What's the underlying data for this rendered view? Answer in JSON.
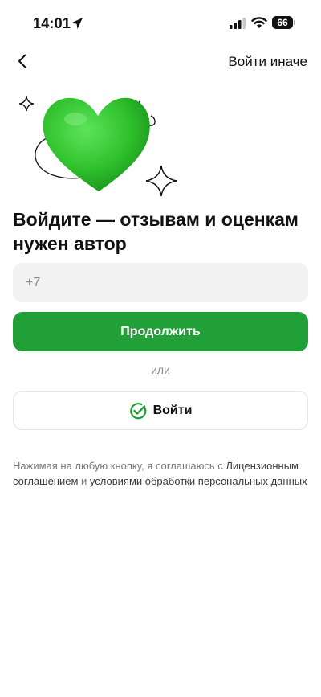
{
  "status_bar": {
    "time": "14:01",
    "battery_level": "66",
    "icons": [
      "location-arrow-icon",
      "cellular-signal-icon",
      "wifi-icon",
      "battery-icon"
    ]
  },
  "nav": {
    "back_icon": "chevron-left-icon",
    "alt_login_label": "Войти иначе"
  },
  "hero": {
    "illustration": "green-heart-illustration",
    "headline": "Войдите — отзывам и оценкам нужен автор"
  },
  "form": {
    "phone_placeholder": "+7",
    "phone_value": "",
    "continue_label": "Продолжить",
    "or_label": "или",
    "sber_login_label": "Войти",
    "sber_icon": "sber-check-icon"
  },
  "legal": {
    "prefix": "Нажимая на любую кнопку, я соглашаюсь с ",
    "license_link": "Лицензионным соглашением",
    "middle": " и ",
    "terms_link": "условиями обработки персональных данных"
  },
  "colors": {
    "accent": "#21a038",
    "field_bg": "#f2f2f2",
    "muted_text": "#8a8a8a"
  }
}
